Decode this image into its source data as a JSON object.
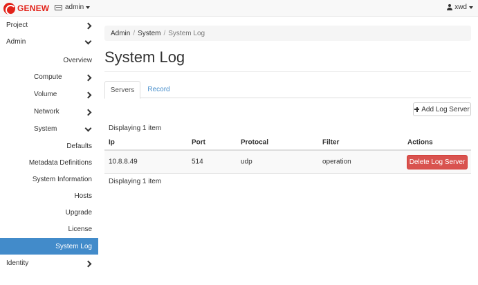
{
  "topbar": {
    "brand": "GENEW",
    "project_menu": "admin",
    "user_menu": "xwd"
  },
  "sidebar": {
    "project": "Project",
    "admin": "Admin",
    "overview": "Overview",
    "compute": "Compute",
    "volume": "Volume",
    "network": "Network",
    "system": "System",
    "defaults": "Defaults",
    "metadata": "Metadata Definitions",
    "system_information": "System Information",
    "hosts": "Hosts",
    "upgrade": "Upgrade",
    "license": "License",
    "system_log": "System Log",
    "identity": "Identity"
  },
  "breadcrumb": {
    "items": [
      "Admin",
      "System",
      "System Log"
    ]
  },
  "page_title": "System Log",
  "tabs": {
    "servers": "Servers",
    "record": "Record"
  },
  "add_button": "Add Log Server",
  "count_label": "Displaying 1 item",
  "table": {
    "headers": {
      "ip": "Ip",
      "port": "Port",
      "protocol": "Protocal",
      "filter": "Filter",
      "actions": "Actions"
    },
    "rows": [
      {
        "ip": "10.8.8.49",
        "port": "514",
        "protocol": "udp",
        "filter": "operation",
        "action": "Delete Log Server"
      }
    ]
  },
  "colors": {
    "accent": "#428bca",
    "danger": "#d9534f",
    "brand": "#e2231a"
  }
}
